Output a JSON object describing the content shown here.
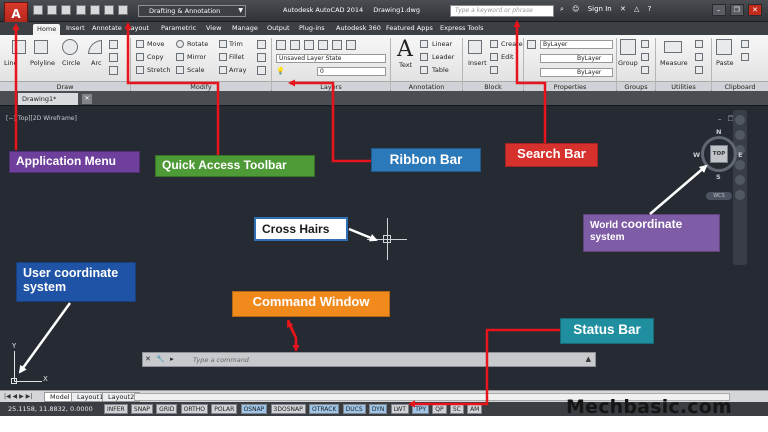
{
  "titlebar": {
    "app_button": "A",
    "workspace": "Drafting & Annotation",
    "app_title": "Autodesk AutoCAD 2014",
    "file_title": "Drawing1.dwg",
    "search_placeholder": "Type a keyword or phrase",
    "sign_in": "Sign In"
  },
  "ribbon_tabs": [
    "Home",
    "Insert",
    "Annotate",
    "Layout",
    "Parametric",
    "View",
    "Manage",
    "Output",
    "Plug-ins",
    "Autodesk 360",
    "Featured Apps",
    "Express Tools"
  ],
  "ribbon": {
    "draw": {
      "title": "Draw",
      "line": "Line",
      "polyline": "Polyline",
      "circle": "Circle",
      "arc": "Arc"
    },
    "modify": {
      "title": "Modify",
      "move": "Move",
      "rotate": "Rotate",
      "trim": "Trim",
      "copy": "Copy",
      "mirror": "Mirror",
      "fillet": "Fillet",
      "stretch": "Stretch",
      "scale": "Scale",
      "array": "Array"
    },
    "layers": {
      "title": "Layers",
      "layer_state": "Unsaved Layer State",
      "current_layer": "0"
    },
    "annotation": {
      "title": "Annotation",
      "text": "Text",
      "linear": "Linear",
      "leader": "Leader",
      "table": "Table"
    },
    "block": {
      "title": "Block",
      "insert": "Insert",
      "create": "Create",
      "edit": "Edit"
    },
    "properties": {
      "title": "Properties",
      "color": "ByLayer",
      "lineweight": "ByLayer",
      "linetype": "ByLayer"
    },
    "groups": {
      "title": "Groups",
      "group": "Group"
    },
    "utilities": {
      "title": "Utilities",
      "measure": "Measure"
    },
    "clipboard": {
      "title": "Clipboard",
      "paste": "Paste"
    }
  },
  "file_tab": {
    "name": "Drawing1*"
  },
  "viewport": {
    "label": "[−][Top][2D Wireframe]",
    "viewcube": {
      "top": "TOP",
      "north": "N",
      "south": "S",
      "east": "E",
      "west": "W",
      "wcs": "WCS"
    },
    "ucs": {
      "x": "X",
      "y": "Y"
    }
  },
  "command_line": {
    "placeholder": "Type a command"
  },
  "layout_tabs": [
    "Model",
    "Layout1",
    "Layout2"
  ],
  "status_bar": {
    "coords": "25.1158, 11.8832, 0.0000",
    "toggles": [
      "INFER",
      "SNAP",
      "GRID",
      "ORTHO",
      "POLAR",
      "OSNAP",
      "3DOSNAP",
      "OTRACK",
      "DUCS",
      "DYN",
      "LWT",
      "TPY",
      "QP",
      "SC",
      "AM"
    ]
  },
  "callouts": {
    "application_menu": "Application Menu",
    "quick_access_toolbar": "Quick Access Toolbar",
    "ribbon_bar": "Ribbon  Bar",
    "search_bar": "Search  Bar",
    "cross_hairs": "Cross Hairs",
    "world_coordinate_system_1": "World",
    "world_coordinate_system_2": "coordinate",
    "world_coordinate_system_3": "system",
    "user_coordinate_system": "User coordinate system",
    "command_window": "Command Window",
    "status_bar": "Status  Bar"
  },
  "watermark": "Mechbasic.com",
  "colors": {
    "arrow": "#e8141b",
    "arrow_white": "#ffffff",
    "application_menu": "#6e3f9b",
    "quick_access_toolbar": "#4e9a36",
    "ribbon_bar": "#2b79b8",
    "search_bar": "#d7312e",
    "world_coordinate": "#7f5ca6",
    "user_coordinate": "#1f53a5",
    "command_window": "#f08a1d",
    "status_bar": "#1f8fa0"
  }
}
